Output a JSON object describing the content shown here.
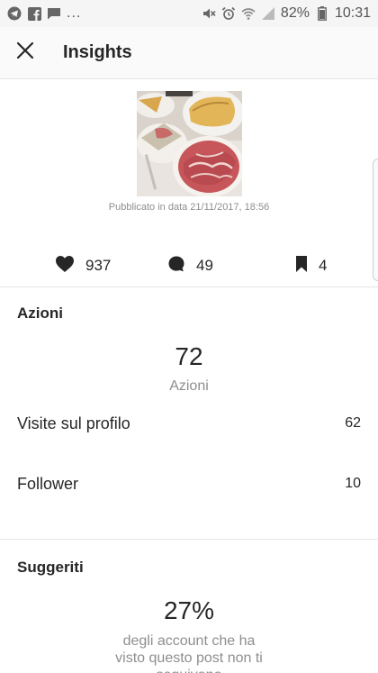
{
  "status_bar": {
    "left_icons": [
      "telegram-icon",
      "facebook-icon",
      "message-icon"
    ],
    "more": "...",
    "right_icons": [
      "mute-icon",
      "alarm-icon",
      "wifi-icon",
      "signal-icon"
    ],
    "battery": "82%",
    "time": "10:31"
  },
  "header": {
    "close_icon": "close-icon",
    "title": "Insights"
  },
  "post": {
    "date": "Pubblicato in data 21/11/2017, 18:56"
  },
  "stats": {
    "likes": "937",
    "comments": "49",
    "saves": "4"
  },
  "actions": {
    "title": "Azioni",
    "total": "72",
    "total_label": "Azioni",
    "rows": [
      {
        "label": "Visite sul profilo",
        "value": "62"
      },
      {
        "label": "Follower",
        "value": "10"
      }
    ]
  },
  "discovery": {
    "title": "Suggeriti",
    "percent": "27%",
    "caption_lines": [
      "degli account che ha",
      "visto questo post non ti",
      "seguivano"
    ]
  }
}
